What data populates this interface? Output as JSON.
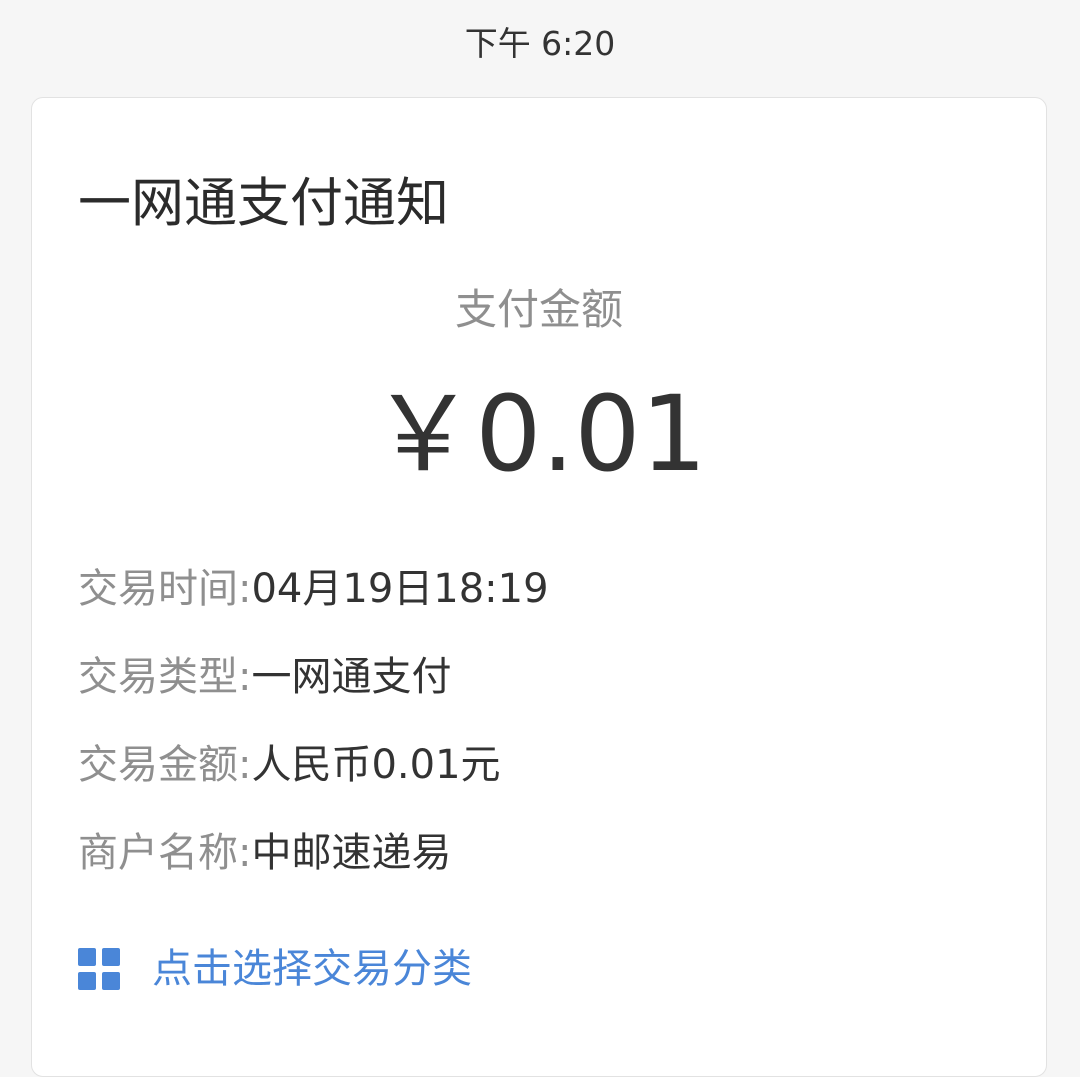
{
  "status_time": "下午 6:20",
  "card": {
    "title": "一网通支付通知",
    "amount_label": "支付金额",
    "amount_value": "￥0.01",
    "details": [
      {
        "label": "交易时间:",
        "value": "04月19日18:19"
      },
      {
        "label": "交易类型:",
        "value": "一网通支付"
      },
      {
        "label": "交易金额:",
        "value": "人民币0.01元"
      },
      {
        "label": "商户名称:",
        "value": "中邮速递易"
      }
    ],
    "category_link": {
      "icon": "grid-icon",
      "label": "点击选择交易分类"
    }
  },
  "colors": {
    "background": "#f6f6f6",
    "card": "#ffffff",
    "primary_text": "#333333",
    "secondary_text": "#8f8f8f",
    "link": "#4a86d8"
  }
}
